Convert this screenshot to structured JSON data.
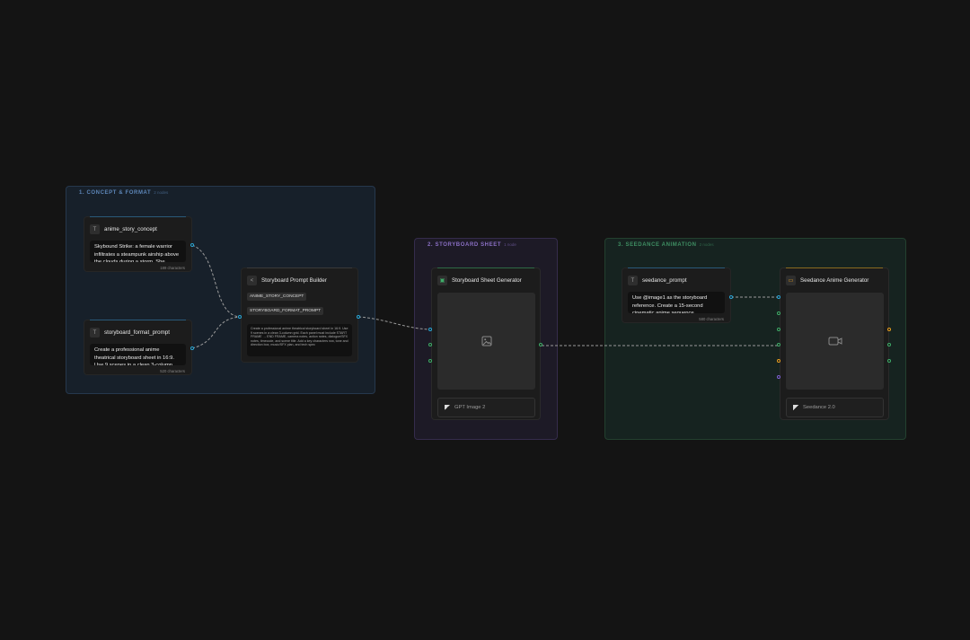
{
  "groups": {
    "concept": {
      "label": "1. CONCEPT & FORMAT",
      "count": "2 nodes"
    },
    "storyboard": {
      "label": "2. STORYBOARD SHEET",
      "count": "1 node"
    },
    "animation": {
      "label": "3. SEEDANCE ANIMATION",
      "count": "2 nodes"
    }
  },
  "nodes": {
    "anime_story_concept": {
      "icon": "T",
      "title": "anime_story_concept",
      "text": "Skybound Strike: a female warrior infiltrates a steampunk airship above the clouds during a storm. She",
      "chars": "189 characters"
    },
    "storyboard_format_prompt": {
      "icon": "T",
      "title": "storyboard_format_prompt",
      "text": "Create a professional anime theatrical storyboard sheet in 16:9. Use 9 scenes in a clean 3-column grid.",
      "chars": "520 characters"
    },
    "prompt_builder": {
      "icon": "<",
      "title": "Storyboard Prompt Builder",
      "tags": [
        "ANIME_STORY_CONCEPT",
        "STORYBOARD_FORMAT_PROMPT"
      ],
      "preview": "Create a professional anime theatrical storyboard sheet in 16:9. Use 9 scenes in a clean 3-column grid. Each panel must include START FRAME → END FRAME, camera notes, action notes, dialogue/SFX notes, timecode, and scene title. Add a key characters row, tone and direction box, music/SFX plan, and tech spec"
    },
    "sheet_generator": {
      "icon": "img-icon",
      "title": "Storyboard Sheet Generator",
      "model": "GPT Image 2"
    },
    "seedance_prompt": {
      "icon": "T",
      "title": "seedance_prompt",
      "text": "Use @image1 as the storyboard reference. Create a 15-second cinematic anime sequence",
      "chars": "580 characters"
    },
    "anime_generator": {
      "icon": "video-icon",
      "title": "Seedance Anime Generator",
      "model": "Seedance 2.0"
    }
  },
  "colors": {
    "accent_blue": "#2aa8d8",
    "accent_green": "#3fae6a",
    "accent_orange": "#e8a020",
    "accent_purple": "#7e63d6"
  }
}
